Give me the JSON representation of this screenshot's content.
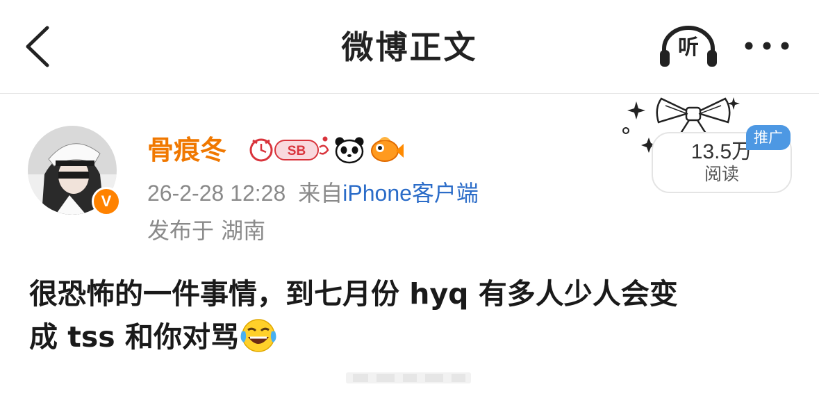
{
  "nav": {
    "title": "微博正文",
    "back_icon": "chevron-left-icon",
    "listen_label": "听",
    "more_icon": "more-dots-icon"
  },
  "post": {
    "author": {
      "name": "骨痕冬",
      "avatar": "user-avatar",
      "verified_badge": "V",
      "badges": [
        "sb-badge",
        "panda-badge",
        "fish-badge"
      ]
    },
    "timestamp": "26-2-28 12:28",
    "source_prefix": "来自",
    "source_client": "iPhone客户端",
    "location": "发布于 湖南",
    "reads": {
      "count": "13.5万",
      "label": "阅读"
    },
    "promo_tag": "推广",
    "content_line1": "很恐怖的一件事情，到七月份 hyq 有多人少人会变",
    "content_line2": "成 tss 和你对骂",
    "emoji": "laughing-crying-emoji"
  },
  "colors": {
    "username": "#f07800",
    "link": "#2b6cc8",
    "meta": "#8a8a8a",
    "verified": "#ff8200",
    "promo": "#4d98e3"
  }
}
